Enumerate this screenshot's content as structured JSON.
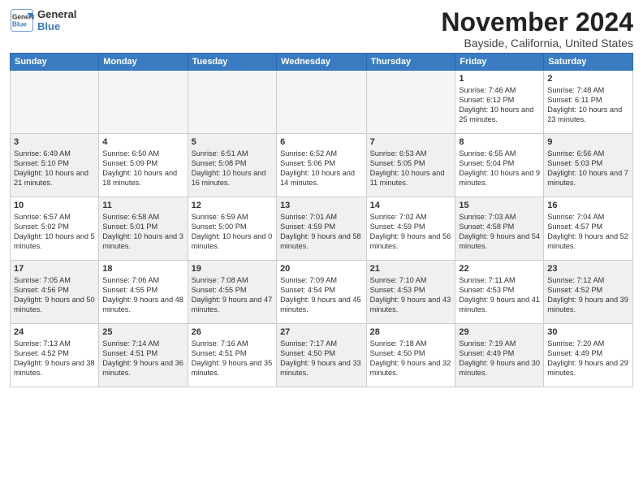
{
  "header": {
    "logo_line1": "General",
    "logo_line2": "Blue",
    "month": "November 2024",
    "location": "Bayside, California, United States"
  },
  "weekdays": [
    "Sunday",
    "Monday",
    "Tuesday",
    "Wednesday",
    "Thursday",
    "Friday",
    "Saturday"
  ],
  "weeks": [
    [
      {
        "day": "",
        "info": "",
        "shaded": true
      },
      {
        "day": "",
        "info": "",
        "shaded": true
      },
      {
        "day": "",
        "info": "",
        "shaded": true
      },
      {
        "day": "",
        "info": "",
        "shaded": true
      },
      {
        "day": "",
        "info": "",
        "shaded": true
      },
      {
        "day": "1",
        "info": "Sunrise: 7:46 AM\nSunset: 6:12 PM\nDaylight: 10 hours\nand 25 minutes.",
        "shaded": false
      },
      {
        "day": "2",
        "info": "Sunrise: 7:48 AM\nSunset: 6:11 PM\nDaylight: 10 hours\nand 23 minutes.",
        "shaded": false
      }
    ],
    [
      {
        "day": "3",
        "info": "Sunrise: 6:49 AM\nSunset: 5:10 PM\nDaylight: 10 hours\nand 21 minutes.",
        "shaded": true
      },
      {
        "day": "4",
        "info": "Sunrise: 6:50 AM\nSunset: 5:09 PM\nDaylight: 10 hours\nand 18 minutes.",
        "shaded": false
      },
      {
        "day": "5",
        "info": "Sunrise: 6:51 AM\nSunset: 5:08 PM\nDaylight: 10 hours\nand 16 minutes.",
        "shaded": true
      },
      {
        "day": "6",
        "info": "Sunrise: 6:52 AM\nSunset: 5:06 PM\nDaylight: 10 hours\nand 14 minutes.",
        "shaded": false
      },
      {
        "day": "7",
        "info": "Sunrise: 6:53 AM\nSunset: 5:05 PM\nDaylight: 10 hours\nand 11 minutes.",
        "shaded": true
      },
      {
        "day": "8",
        "info": "Sunrise: 6:55 AM\nSunset: 5:04 PM\nDaylight: 10 hours\nand 9 minutes.",
        "shaded": false
      },
      {
        "day": "9",
        "info": "Sunrise: 6:56 AM\nSunset: 5:03 PM\nDaylight: 10 hours\nand 7 minutes.",
        "shaded": true
      }
    ],
    [
      {
        "day": "10",
        "info": "Sunrise: 6:57 AM\nSunset: 5:02 PM\nDaylight: 10 hours\nand 5 minutes.",
        "shaded": false
      },
      {
        "day": "11",
        "info": "Sunrise: 6:58 AM\nSunset: 5:01 PM\nDaylight: 10 hours\nand 3 minutes.",
        "shaded": true
      },
      {
        "day": "12",
        "info": "Sunrise: 6:59 AM\nSunset: 5:00 PM\nDaylight: 10 hours\nand 0 minutes.",
        "shaded": false
      },
      {
        "day": "13",
        "info": "Sunrise: 7:01 AM\nSunset: 4:59 PM\nDaylight: 9 hours\nand 58 minutes.",
        "shaded": true
      },
      {
        "day": "14",
        "info": "Sunrise: 7:02 AM\nSunset: 4:59 PM\nDaylight: 9 hours\nand 56 minutes.",
        "shaded": false
      },
      {
        "day": "15",
        "info": "Sunrise: 7:03 AM\nSunset: 4:58 PM\nDaylight: 9 hours\nand 54 minutes.",
        "shaded": true
      },
      {
        "day": "16",
        "info": "Sunrise: 7:04 AM\nSunset: 4:57 PM\nDaylight: 9 hours\nand 52 minutes.",
        "shaded": false
      }
    ],
    [
      {
        "day": "17",
        "info": "Sunrise: 7:05 AM\nSunset: 4:56 PM\nDaylight: 9 hours\nand 50 minutes.",
        "shaded": true
      },
      {
        "day": "18",
        "info": "Sunrise: 7:06 AM\nSunset: 4:55 PM\nDaylight: 9 hours\nand 48 minutes.",
        "shaded": false
      },
      {
        "day": "19",
        "info": "Sunrise: 7:08 AM\nSunset: 4:55 PM\nDaylight: 9 hours\nand 47 minutes.",
        "shaded": true
      },
      {
        "day": "20",
        "info": "Sunrise: 7:09 AM\nSunset: 4:54 PM\nDaylight: 9 hours\nand 45 minutes.",
        "shaded": false
      },
      {
        "day": "21",
        "info": "Sunrise: 7:10 AM\nSunset: 4:53 PM\nDaylight: 9 hours\nand 43 minutes.",
        "shaded": true
      },
      {
        "day": "22",
        "info": "Sunrise: 7:11 AM\nSunset: 4:53 PM\nDaylight: 9 hours\nand 41 minutes.",
        "shaded": false
      },
      {
        "day": "23",
        "info": "Sunrise: 7:12 AM\nSunset: 4:52 PM\nDaylight: 9 hours\nand 39 minutes.",
        "shaded": true
      }
    ],
    [
      {
        "day": "24",
        "info": "Sunrise: 7:13 AM\nSunset: 4:52 PM\nDaylight: 9 hours\nand 38 minutes.",
        "shaded": false
      },
      {
        "day": "25",
        "info": "Sunrise: 7:14 AM\nSunset: 4:51 PM\nDaylight: 9 hours\nand 36 minutes.",
        "shaded": true
      },
      {
        "day": "26",
        "info": "Sunrise: 7:16 AM\nSunset: 4:51 PM\nDaylight: 9 hours\nand 35 minutes.",
        "shaded": false
      },
      {
        "day": "27",
        "info": "Sunrise: 7:17 AM\nSunset: 4:50 PM\nDaylight: 9 hours\nand 33 minutes.",
        "shaded": true
      },
      {
        "day": "28",
        "info": "Sunrise: 7:18 AM\nSunset: 4:50 PM\nDaylight: 9 hours\nand 32 minutes.",
        "shaded": false
      },
      {
        "day": "29",
        "info": "Sunrise: 7:19 AM\nSunset: 4:49 PM\nDaylight: 9 hours\nand 30 minutes.",
        "shaded": true
      },
      {
        "day": "30",
        "info": "Sunrise: 7:20 AM\nSunset: 4:49 PM\nDaylight: 9 hours\nand 29 minutes.",
        "shaded": false
      }
    ]
  ]
}
